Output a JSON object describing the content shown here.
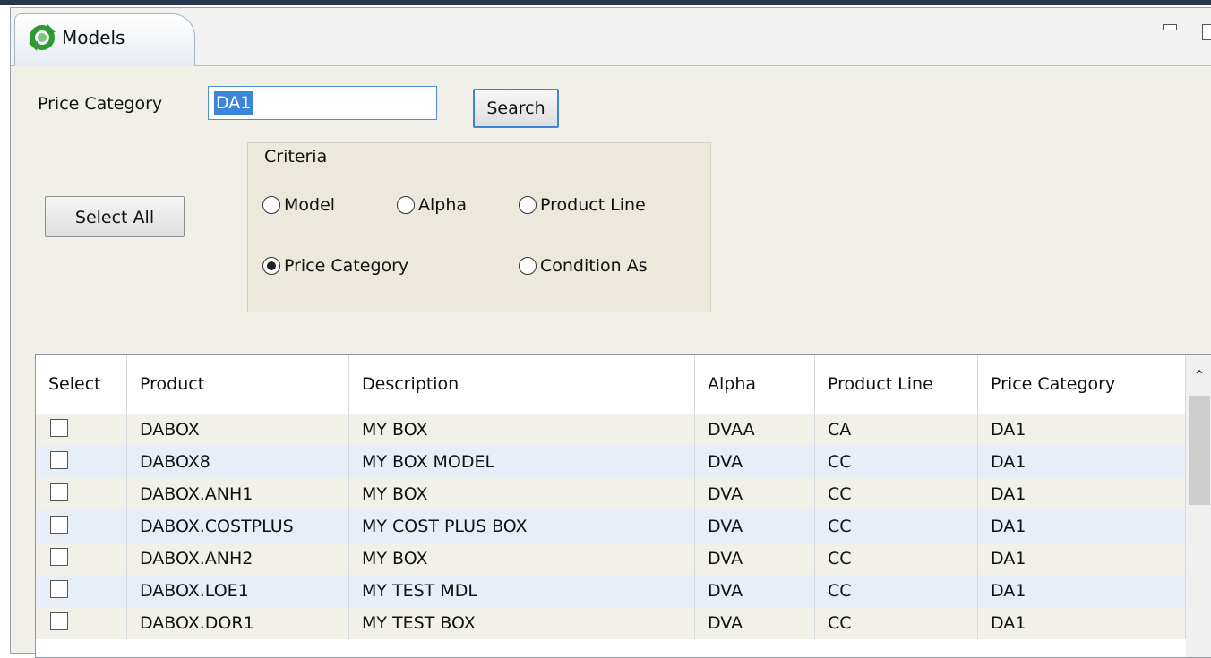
{
  "tab": {
    "label": "Models",
    "icon": "refresh-icon"
  },
  "form": {
    "price_category_label": "Price Category",
    "price_category_value": "DA1",
    "search_button": "Search",
    "select_all_button": "Select All"
  },
  "criteria": {
    "legend": "Criteria",
    "options": {
      "model": "Model",
      "alpha": "Alpha",
      "product_line": "Product Line",
      "price_category": "Price Category",
      "condition_as": "Condition As"
    },
    "selected": "Price Category"
  },
  "table": {
    "columns": [
      "Select",
      "Product",
      "Description",
      "Alpha",
      "Product Line",
      "Price Category"
    ],
    "rows": [
      {
        "checked": false,
        "product": "DABOX",
        "description": "MY BOX",
        "alpha": "DVAA",
        "product_line": "CA",
        "price_category": "DA1"
      },
      {
        "checked": false,
        "product": "DABOX8",
        "description": "MY BOX MODEL",
        "alpha": "DVA",
        "product_line": "CC",
        "price_category": "DA1"
      },
      {
        "checked": false,
        "product": "DABOX.ANH1",
        "description": "MY BOX",
        "alpha": "DVA",
        "product_line": "CC",
        "price_category": "DA1"
      },
      {
        "checked": false,
        "product": "DABOX.COSTPLUS",
        "description": "MY COST PLUS BOX",
        "alpha": "DVA",
        "product_line": "CC",
        "price_category": "DA1"
      },
      {
        "checked": false,
        "product": "DABOX.ANH2",
        "description": "MY BOX",
        "alpha": "DVA",
        "product_line": "CC",
        "price_category": "DA1"
      },
      {
        "checked": false,
        "product": "DABOX.LOE1",
        "description": "MY TEST MDL",
        "alpha": "DVA",
        "product_line": "CC",
        "price_category": "DA1"
      },
      {
        "checked": false,
        "product": "DABOX.DOR1",
        "description": "MY TEST BOX",
        "alpha": "DVA",
        "product_line": "CC",
        "price_category": "DA1"
      }
    ]
  },
  "colors": {
    "accent": "#3b86d8",
    "panel_bg": "#f0efe8",
    "row_alt": "#e8eef7"
  }
}
